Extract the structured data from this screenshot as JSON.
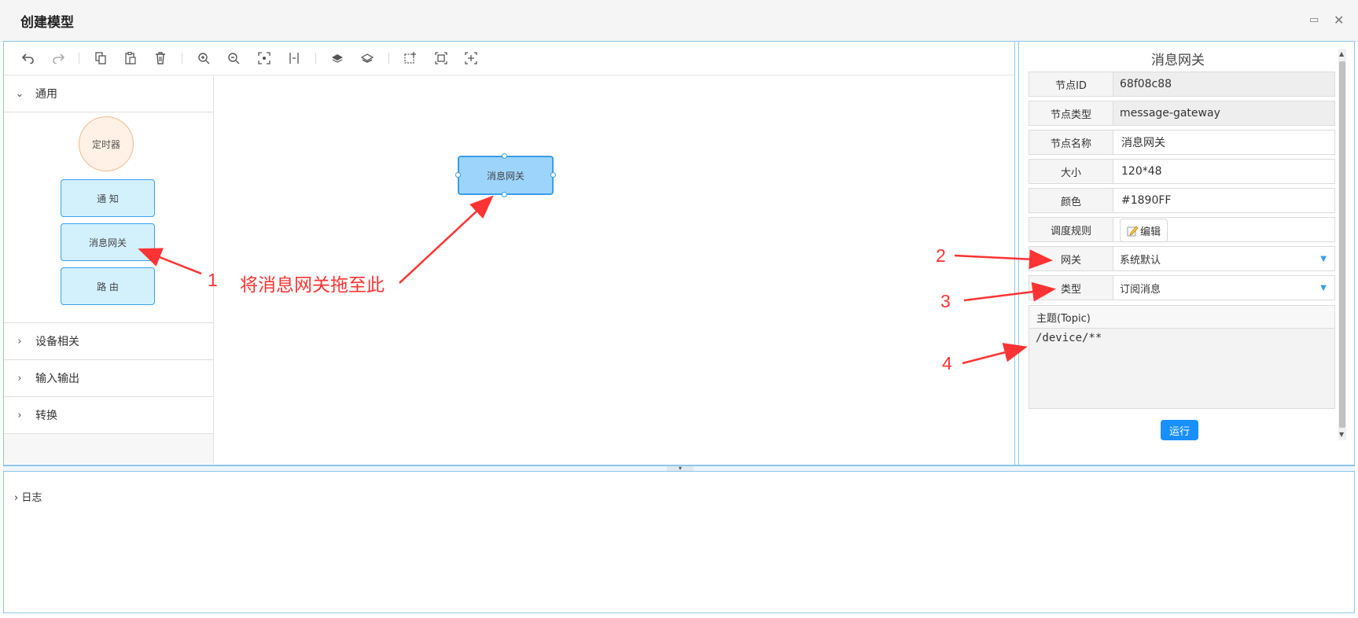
{
  "window": {
    "title": "创建模型",
    "maximize_glyph": "▭",
    "close_glyph": "✕"
  },
  "toolbar": {
    "icons": [
      "undo-icon",
      "redo-icon",
      "copy-icon",
      "paste-icon",
      "delete-icon",
      "zoom-in-icon",
      "zoom-out-icon",
      "fit-icon",
      "actual-size-icon",
      "to-front-icon",
      "to-back-icon",
      "select-icon",
      "marquee-icon",
      "auto-layout-icon"
    ]
  },
  "palette": {
    "general_label": "通用",
    "nodes": {
      "timer": "定时器",
      "notify": "通 知",
      "message_gateway": "消息网关",
      "route": "路 由"
    },
    "categories": {
      "device": "设备相关",
      "io": "输入输出",
      "convert": "转换"
    }
  },
  "canvas": {
    "node_label": "消息网关"
  },
  "properties": {
    "title": "消息网关",
    "rows": {
      "node_id": {
        "label": "节点ID",
        "value": "68f08c88"
      },
      "node_type": {
        "label": "节点类型",
        "value": "message-gateway"
      },
      "node_name": {
        "label": "节点名称",
        "value": "消息网关"
      },
      "size": {
        "label": "大小",
        "value": "120*48"
      },
      "color": {
        "label": "颜色",
        "value": "#1890FF"
      },
      "schedule": {
        "label": "调度规则",
        "button": "编辑"
      },
      "gateway": {
        "label": "网关",
        "value": "系统默认"
      },
      "type": {
        "label": "类型",
        "value": "订阅消息"
      }
    },
    "topic": {
      "label": "主题(Topic)",
      "value": "/device/**"
    },
    "run_label": "运行"
  },
  "log": {
    "label": "日志"
  },
  "annotations": {
    "n1": "1",
    "n1_text": "将消息网关拖至此",
    "n2": "2",
    "n3": "3",
    "n4": "4",
    "color": "#ff3333"
  }
}
